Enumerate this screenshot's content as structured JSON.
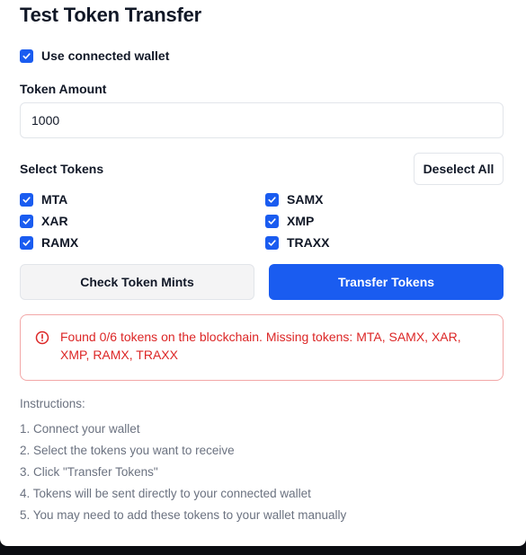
{
  "title": "Test Token Transfer",
  "use_wallet": {
    "label": "Use connected wallet",
    "checked": true
  },
  "token_amount": {
    "label": "Token Amount",
    "value": "1000"
  },
  "select_tokens": {
    "label": "Select Tokens",
    "deselect_label": "Deselect All",
    "tokens": [
      {
        "name": "MTA",
        "checked": true
      },
      {
        "name": "SAMX",
        "checked": true
      },
      {
        "name": "XAR",
        "checked": true
      },
      {
        "name": "XMP",
        "checked": true
      },
      {
        "name": "RAMX",
        "checked": true
      },
      {
        "name": "TRAXX",
        "checked": true
      }
    ]
  },
  "buttons": {
    "check_mints": "Check Token Mints",
    "transfer": "Transfer Tokens"
  },
  "alert": {
    "message": "Found 0/6 tokens on the blockchain. Missing tokens: MTA, SAMX, XAR, XMP, RAMX, TRAXX",
    "icon": "alert-circle-icon"
  },
  "instructions": {
    "heading": "Instructions:",
    "steps": [
      "1. Connect your wallet",
      "2. Select the tokens you want to receive",
      "3. Click \"Transfer Tokens\"",
      "4. Tokens will be sent directly to your connected wallet",
      "5. You may need to add these tokens to your wallet manually"
    ]
  },
  "colors": {
    "accent": "#1a5cf0",
    "error": "#dc2626",
    "error_border": "#f2a7a7",
    "muted_text": "#6b7280"
  }
}
